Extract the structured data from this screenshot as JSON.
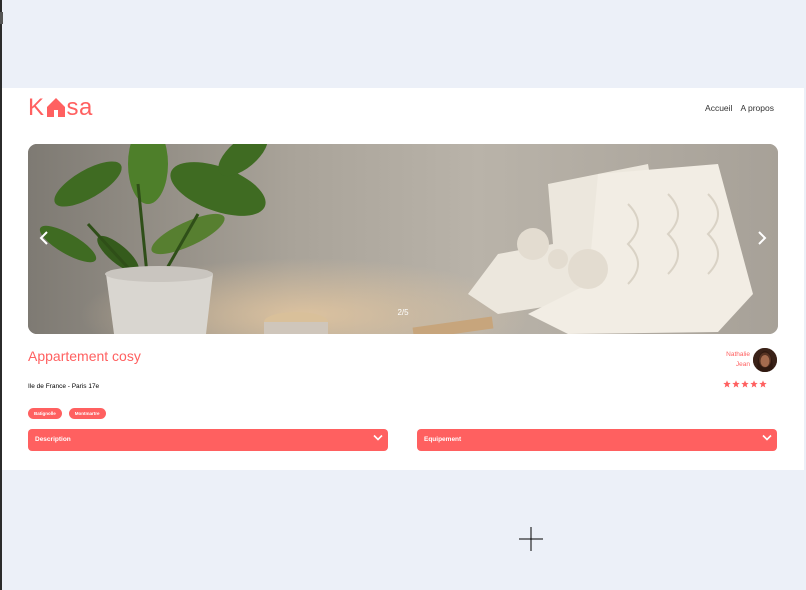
{
  "header": {
    "logo_k": "K",
    "logo_sa": "sa",
    "nav": [
      {
        "label": "Accueil"
      },
      {
        "label": "A propos"
      }
    ]
  },
  "carousel": {
    "counter": "2/5",
    "previous_icon": "chevron-left-icon",
    "next_icon": "chevron-right-icon"
  },
  "listing": {
    "title": "Appartement cosy",
    "location": "Ile de France - Paris 17e",
    "tags": [
      "Batignolle",
      "Montmartre"
    ],
    "host": {
      "first_name": "Nathalie",
      "last_name": "Jean"
    },
    "rating": {
      "value": 5,
      "max": 5
    }
  },
  "collapses": {
    "description": {
      "label": "Description"
    },
    "equipment": {
      "label": "Equipement"
    }
  },
  "colors": {
    "accent": "#FF6060",
    "background": "#ECF0F8"
  }
}
